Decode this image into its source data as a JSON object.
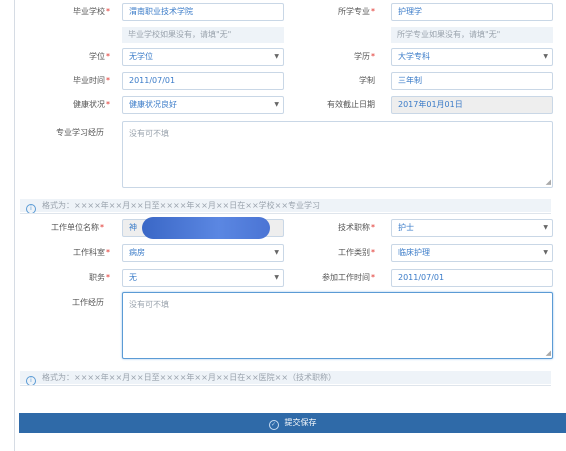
{
  "education": {
    "school_label": "毕业学校",
    "school_value": "渭南职业技术学院",
    "school_hint": "毕业学校如果没有，请填\"无\"",
    "major_label": "所学专业",
    "major_value": "护理学",
    "major_hint": "所学专业如果没有，请填\"无\"",
    "degree_label": "学位",
    "degree_value": "无学位",
    "edu_label": "学历",
    "edu_value": "大学专科",
    "grad_time_label": "毕业时间",
    "grad_time_value": "2011/07/01",
    "system_label": "学制",
    "system_value": "三年制",
    "health_label": "健康状况",
    "health_value": "健康状况良好",
    "valid_label": "有效截止日期",
    "valid_value": "2017年01月01日",
    "study_label": "专业学习经历",
    "study_placeholder": "没有可不填",
    "tip": "格式为：××××年××月××日至××××年××月××日在××学校××专业学习"
  },
  "work": {
    "unit_label": "工作单位名称",
    "unit_value": "神",
    "title_label": "技术职称",
    "title_value": "护士",
    "dept_label": "工作科室",
    "dept_value": "病房",
    "type_label": "工作类别",
    "type_value": "临床护理",
    "duty_label": "职务",
    "duty_value": "无",
    "join_label": "参加工作时间",
    "join_value": "2011/07/01",
    "exp_label": "工作经历",
    "exp_placeholder": "没有可不填",
    "tip": "格式为：××××年××月××日至××××年××月××日在××医院××（技术职称）"
  },
  "required_mark": "*",
  "caret": "▼",
  "info_icon": "i",
  "check_icon": "✓",
  "submit_label": "提交保存",
  "colors": {
    "accent": "#2f6aa8",
    "required": "#e0312a",
    "value": "#3a7bc8"
  }
}
